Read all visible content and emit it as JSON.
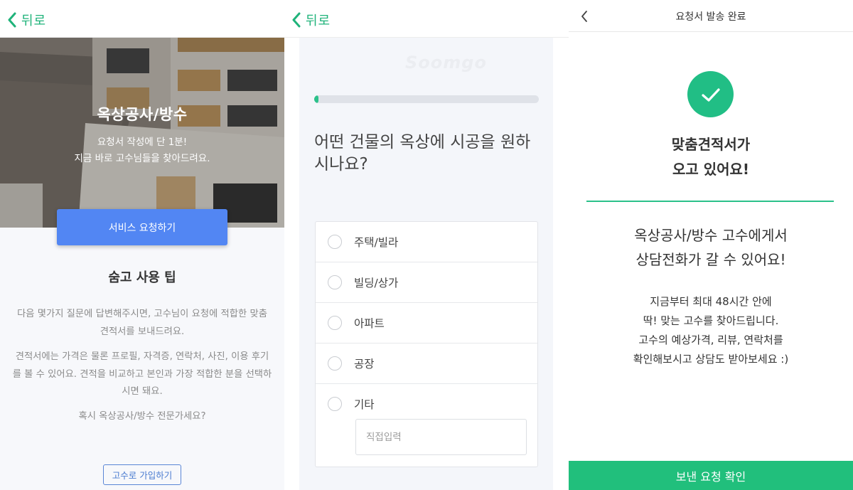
{
  "colors": {
    "green": "#1fb37a",
    "blue": "#5286f3",
    "check": "#21be85",
    "bottom_button": "#21bf7c"
  },
  "screen1": {
    "back_label": "뒤로",
    "hero_title": "옥상공사/방수",
    "hero_subtitle_1": "요청서 작성에 단 1분!",
    "hero_subtitle_2": "지금 바로 고수님들을 찾아드려요.",
    "cta_label": "서비스 요청하기",
    "tips_title": "숨고 사용 팁",
    "tip_1": "다음 몇가지 질문에 답변해주시면, 고수님이 요청에 적합한 맞춤 견적서를 보내드려요.",
    "tip_2": "견적서에는 가격은 물론 프로필, 자격증, 연락처, 사진, 이용 후기를 볼 수 있어요. 견적을 비교하고 본인과 가장 적합한 분을 선택하시면 돼요.",
    "tip_3": "혹시 옥상공사/방수 전문가세요?",
    "join_label": "고수로 가입하기"
  },
  "screen2": {
    "back_label": "뒤로",
    "watermark": "Soomgo",
    "progress": 0.02,
    "question": "어떤 건물의 옥상에 시공을 원하시나요?",
    "options": [
      "주택/빌라",
      "빌딩/상가",
      "아파트",
      "공장",
      "기타"
    ],
    "direct_input_placeholder": "직접입력"
  },
  "screen3": {
    "title": "요청서 발송 완료",
    "heading_1": "맞춤견적서가",
    "heading_2": "오고 있어요!",
    "message_1": "옥상공사/방수 고수에게서",
    "message_2": "상담전화가 갈 수 있어요!",
    "info_1": "지금부터 최대 48시간 안에",
    "info_2": "딱! 맞는 고수를 찾아드립니다.",
    "info_3": "고수의 예상가격, 리뷰, 연락처를",
    "info_4": "확인해보시고 상담도 받아보세요 :)",
    "confirm_label": "보낸 요청 확인"
  }
}
